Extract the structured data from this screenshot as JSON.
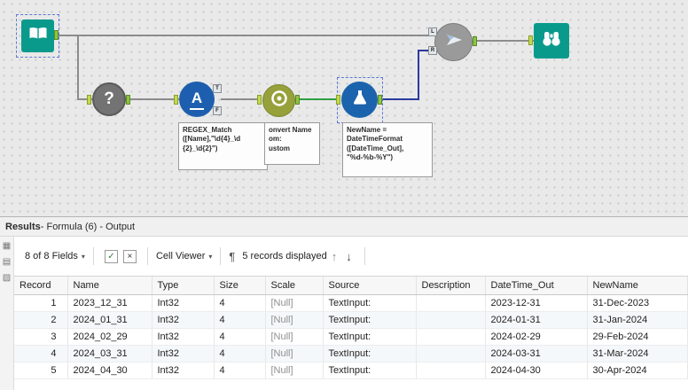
{
  "canvas": {
    "tool_glyphs": {
      "question_mark": "?",
      "regex_letter": "A"
    },
    "anchor_labels": {
      "t": "T",
      "f": "F",
      "l": "L",
      "r": "R"
    },
    "annotations": {
      "regex": [
        "REGEX_Match",
        "([Name],\"\\d{4}_\\d",
        "{2}_\\d{2}\")"
      ],
      "datetime_clipped": [
        "onvert Name",
        "om:",
        "ustom"
      ],
      "formula": [
        "NewName =",
        "DateTimeFormat",
        "([DateTime_Out],",
        "\"%d-%b-%Y\")"
      ]
    }
  },
  "results": {
    "title_bold": "Results",
    "title_rest": " - Formula (6) - Output",
    "toolbar": {
      "fields_label": "8 of 8 Fields",
      "caret": "▾",
      "checkmark_icon": "✓",
      "x_icon": "×",
      "cell_viewer_label": "Cell Viewer",
      "paragraph_icon": "¶",
      "records_label": "5 records displayed",
      "up_arrow": "↑",
      "down_arrow": "↓"
    },
    "rail_icons": {
      "table_view": "▦",
      "metadata_view": "▤",
      "profile_view": "▧"
    },
    "table": {
      "columns": [
        "Record",
        "Name",
        "Type",
        "Size",
        "Scale",
        "Source",
        "Description",
        "DateTime_Out",
        "NewName"
      ],
      "rows": [
        [
          "1",
          "2023_12_31",
          "Int32",
          "4",
          "[Null]",
          "TextInput:",
          "",
          "2023-12-31",
          "31-Dec-2023"
        ],
        [
          "2",
          "2024_01_31",
          "Int32",
          "4",
          "[Null]",
          "TextInput:",
          "",
          "2024-01-31",
          "31-Jan-2024"
        ],
        [
          "3",
          "2024_02_29",
          "Int32",
          "4",
          "[Null]",
          "TextInput:",
          "",
          "2024-02-29",
          "29-Feb-2024"
        ],
        [
          "4",
          "2024_03_31",
          "Int32",
          "4",
          "[Null]",
          "TextInput:",
          "",
          "2024-03-31",
          "31-Mar-2024"
        ],
        [
          "5",
          "2024_04_30",
          "Int32",
          "4",
          "[Null]",
          "TextInput:",
          "",
          "2024-04-30",
          "30-Apr-2024"
        ]
      ]
    }
  },
  "colors": {
    "teal": "#0a9a8c",
    "regex_blue": "#1d5fae",
    "formula_blue": "#1b63ad",
    "datetime_olive": "#97a13b",
    "gray_tool": "#9a9a9a",
    "selected_wire": "#2b3a9e",
    "green_wire": "#2f9e41"
  }
}
